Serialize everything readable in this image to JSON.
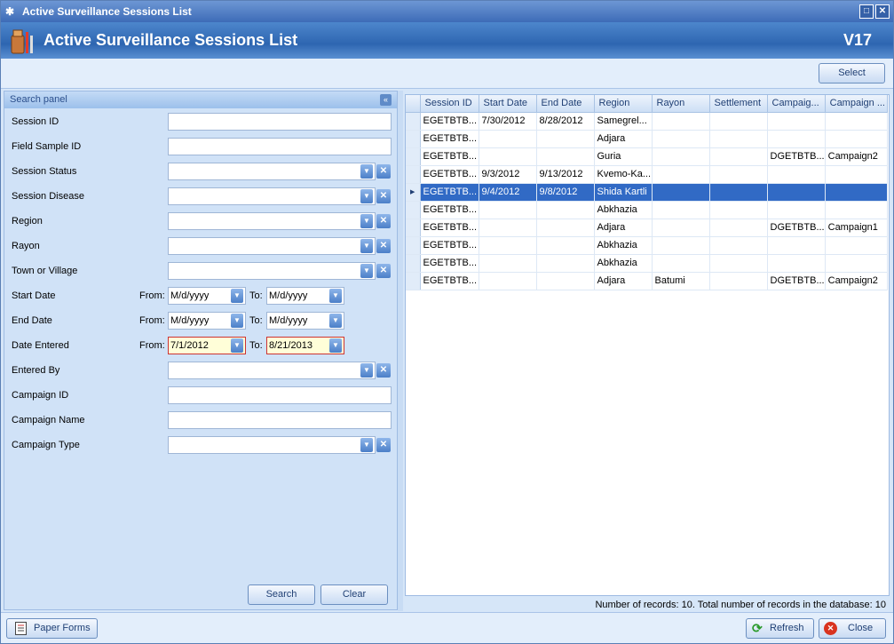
{
  "window": {
    "title": "Active Surveillance Sessions List"
  },
  "header": {
    "title": "Active Surveillance Sessions List",
    "version": "V17"
  },
  "toolbar": {
    "select_label": "Select"
  },
  "search": {
    "panel_title": "Search panel",
    "fields": {
      "session_id": "Session ID",
      "field_sample_id": "Field Sample ID",
      "session_status": "Session Status",
      "session_disease": "Session Disease",
      "region": "Region",
      "rayon": "Rayon",
      "town": "Town or Village",
      "start_date": "Start Date",
      "end_date": "End Date",
      "date_entered": "Date Entered",
      "entered_by": "Entered By",
      "campaign_id": "Campaign ID",
      "campaign_name": "Campaign Name",
      "campaign_type": "Campaign Type"
    },
    "from_label": "From:",
    "to_label": "To:",
    "start_from": "M/d/yyyy",
    "start_to": "M/d/yyyy",
    "end_from": "M/d/yyyy",
    "end_to": "M/d/yyyy",
    "entered_from": "7/1/2012",
    "entered_to": "8/21/2013",
    "search_label": "Search",
    "clear_label": "Clear"
  },
  "grid": {
    "columns": [
      "Session ID",
      "Start Date",
      "End Date",
      "Region",
      "Rayon",
      "Settlement",
      "Campaig...",
      "Campaign ..."
    ],
    "rows": [
      [
        "EGETBTB...",
        "7/30/2012",
        "8/28/2012",
        "Samegrel...",
        "",
        "",
        "",
        ""
      ],
      [
        "EGETBTB...",
        "",
        "",
        "Adjara",
        "",
        "",
        "",
        ""
      ],
      [
        "EGETBTB...",
        "",
        "",
        "Guria",
        "",
        "",
        "DGETBTB...",
        "Campaign2"
      ],
      [
        "EGETBTB...",
        "9/3/2012",
        "9/13/2012",
        "Kvemo-Ka...",
        "",
        "",
        "",
        ""
      ],
      [
        "EGETBTB...",
        "9/4/2012",
        "9/8/2012",
        "Shida Kartli",
        "",
        "",
        "",
        ""
      ],
      [
        "EGETBTB...",
        "",
        "",
        "Abkhazia",
        "",
        "",
        "",
        ""
      ],
      [
        "EGETBTB...",
        "",
        "",
        "Adjara",
        "",
        "",
        "DGETBTB...",
        "Campaign1"
      ],
      [
        "EGETBTB...",
        "",
        "",
        "Abkhazia",
        "",
        "",
        "",
        ""
      ],
      [
        "EGETBTB...",
        "",
        "",
        "Abkhazia",
        "",
        "",
        "",
        ""
      ],
      [
        "EGETBTB...",
        "",
        "",
        "Adjara",
        "Batumi",
        "",
        "DGETBTB...",
        "Campaign2"
      ]
    ],
    "selected_index": 4,
    "status": "Number of records: 10. Total number of records in the database: 10"
  },
  "bottom": {
    "paper_forms_label": "Paper Forms",
    "refresh_label": "Refresh",
    "close_label": "Close"
  },
  "colors": {
    "accent": "#316ac5",
    "header": "#2e66b1",
    "panel": "#d0e2f7",
    "warning_border": "#cc3333"
  }
}
